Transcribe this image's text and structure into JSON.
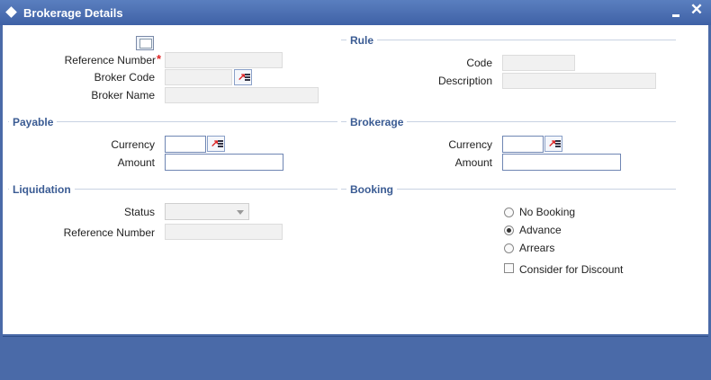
{
  "window": {
    "title": "Brokerage Details",
    "min_icon": "minimize-icon",
    "close_icon": "close-icon",
    "close_glyph": "✕"
  },
  "main": {
    "reference_number_label": "Reference Number",
    "reference_number_value": "",
    "required_mark": "*",
    "broker_code_label": "Broker Code",
    "broker_code_value": "",
    "broker_name_label": "Broker Name",
    "broker_name_value": ""
  },
  "rule": {
    "heading": "Rule",
    "code_label": "Code",
    "code_value": "",
    "description_label": "Description",
    "description_value": ""
  },
  "payable": {
    "heading": "Payable",
    "currency_label": "Currency",
    "currency_value": "",
    "amount_label": "Amount",
    "amount_value": ""
  },
  "brokerage": {
    "heading": "Brokerage",
    "currency_label": "Currency",
    "currency_value": "",
    "amount_label": "Amount",
    "amount_value": ""
  },
  "liquidation": {
    "heading": "Liquidation",
    "status_label": "Status",
    "status_value": "",
    "reference_number_label": "Reference Number",
    "reference_number_value": ""
  },
  "booking": {
    "heading": "Booking",
    "options": [
      "No Booking",
      "Advance",
      "Arrears"
    ],
    "selected": "Advance",
    "consider_discount_label": "Consider for Discount",
    "consider_discount_checked": false
  },
  "colors": {
    "title_bar": "#4a6aa8",
    "section_heading": "#3a5b93",
    "required": "#dd2222"
  }
}
